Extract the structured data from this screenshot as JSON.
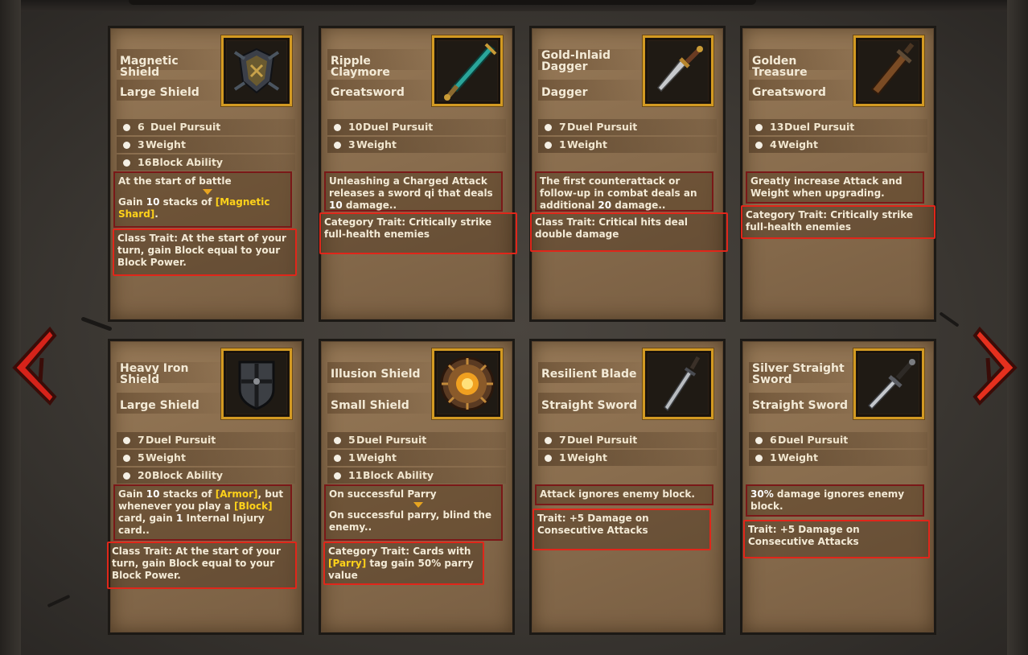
{
  "colors": {
    "accent": "#d39a22",
    "highlight_border": "#e0261a",
    "nav_arrow": "#d6231a",
    "keyword": "#ffd21a",
    "card": "#8a6c4c"
  },
  "nav": {
    "prev_icon": "chevron-left-icon",
    "next_icon": "chevron-right-icon"
  },
  "cards": [
    {
      "name": "Magnetic Shield",
      "type": "Large Shield",
      "icon": "magnetic-shield-icon",
      "stats": [
        {
          "num": "6",
          "label": "Duel Pursuit"
        },
        {
          "num": "3",
          "label": "Weight"
        },
        {
          "num": "16",
          "label": "Block Ability"
        }
      ],
      "effect": {
        "trigger": "At the start of battle",
        "pre": "Gain ",
        "num": "10",
        "mid": " stacks of ",
        "kw": "[Magnetic Shard]",
        "post": "."
      },
      "trait": "Class Trait: At the start of your turn, gain Block equal to your Block Power."
    },
    {
      "name": "Ripple Claymore",
      "type": "Greatsword",
      "icon": "claymore-icon",
      "stats": [
        {
          "num": "10",
          "label": "Duel Pursuit"
        },
        {
          "num": "3",
          "label": "Weight"
        }
      ],
      "effect": {
        "pre": "Unleashing a Charged Attack releases a sword qi that deals ",
        "num": "10",
        "post": " damage.."
      },
      "trait": "Category Trait: Critically strike full-health enemies"
    },
    {
      "name": "Gold-Inlaid Dagger",
      "type": "Dagger",
      "icon": "dagger-icon",
      "stats": [
        {
          "num": "7",
          "label": "Duel Pursuit"
        },
        {
          "num": "1",
          "label": "Weight"
        }
      ],
      "effect": {
        "pre": "The first counterattack or follow-up in combat deals an additional ",
        "num": "20",
        "post": " damage.."
      },
      "trait": "Class Trait: Critical hits deal double damage"
    },
    {
      "name": "Golden Treasure",
      "type": "Greatsword",
      "icon": "golden-greatsword-icon",
      "stats": [
        {
          "num": "13",
          "label": "Duel Pursuit"
        },
        {
          "num": "4",
          "label": "Weight"
        }
      ],
      "effect": {
        "text": "Greatly increase Attack and Weight when upgrading."
      },
      "trait": "Category Trait: Critically strike full-health enemies"
    },
    {
      "name": "Heavy Iron Shield",
      "type": "Large Shield",
      "icon": "iron-shield-icon",
      "stats": [
        {
          "num": "7",
          "label": "Duel Pursuit"
        },
        {
          "num": "5",
          "label": "Weight"
        },
        {
          "num": "20",
          "label": "Block Ability"
        }
      ],
      "effect": {
        "p1": "Gain ",
        "n1": "10",
        "p2": " stacks of ",
        "k1": "[Armor]",
        "p3": ", but whenever you play a ",
        "k2": "[Block]",
        "p4": " card, gain ",
        "n2": "1",
        "p5": " Internal Injury card.."
      },
      "trait": "Class Trait: At the start of your turn, gain Block equal to your Block Power."
    },
    {
      "name": "Illusion Shield",
      "type": "Small Shield",
      "icon": "illusion-shield-icon",
      "stats": [
        {
          "num": "5",
          "label": "Duel Pursuit"
        },
        {
          "num": "1",
          "label": "Weight"
        },
        {
          "num": "11",
          "label": "Block Ability"
        }
      ],
      "effect": {
        "trigger": "On successful Parry",
        "text": "On successful parry, blind the enemy.."
      },
      "trait": {
        "pre": "Category Trait: Cards with ",
        "kw": "[Parry]",
        "post": " tag gain 50% parry value"
      }
    },
    {
      "name": "Resilient Blade",
      "type": "Straight Sword",
      "icon": "straight-sword-icon",
      "stats": [
        {
          "num": "7",
          "label": "Duel Pursuit"
        },
        {
          "num": "1",
          "label": "Weight"
        }
      ],
      "effect": {
        "text": "Attack ignores enemy block."
      },
      "trait": "Trait: +5 Damage on Consecutive Attacks"
    },
    {
      "name": "Silver Straight Sword",
      "type": "Straight Sword",
      "icon": "silver-sword-icon",
      "stats": [
        {
          "num": "6",
          "label": "Duel Pursuit"
        },
        {
          "num": "1",
          "label": "Weight"
        }
      ],
      "effect": {
        "num": "30%",
        "post": " damage ignores enemy block."
      },
      "trait": "Trait: +5 Damage on Consecutive Attacks"
    }
  ]
}
